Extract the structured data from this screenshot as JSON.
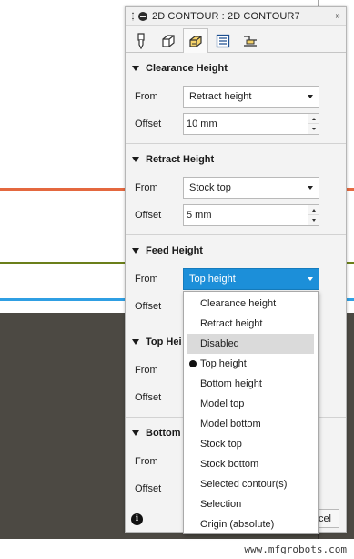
{
  "colors": {
    "orange_line": "#e4683f",
    "green_line": "#6b7f1a",
    "blue_line": "#2f9fe3",
    "dark_area": "#4c4943",
    "accent": "#1c8fd9"
  },
  "panel": {
    "title": "2D CONTOUR : 2D CONTOUR7",
    "expand_icon": "double-chevron-right-icon",
    "tabs": [
      {
        "icon": "tool-icon",
        "active": false
      },
      {
        "icon": "geometry-icon",
        "active": false
      },
      {
        "icon": "heights-icon",
        "active": true
      },
      {
        "icon": "passes-icon",
        "active": false
      },
      {
        "icon": "linking-icon",
        "active": false
      }
    ]
  },
  "clearance": {
    "title": "Clearance Height",
    "from_label": "From",
    "from_value": "Retract height",
    "offset_label": "Offset",
    "offset_value": "10 mm"
  },
  "retract": {
    "title": "Retract Height",
    "from_label": "From",
    "from_value": "Stock top",
    "offset_label": "Offset",
    "offset_value": "5 mm"
  },
  "feed": {
    "title": "Feed Height",
    "from_label": "From",
    "from_value": "Top height",
    "offset_label": "Offset"
  },
  "top": {
    "title": "Top Hei",
    "from_label": "From",
    "offset_label": "Offset"
  },
  "bottom": {
    "title": "Bottom",
    "from_label": "From",
    "offset_label": "Offset"
  },
  "footer": {
    "info_glyph": "i",
    "cancel_label": "cel"
  },
  "dropdown": {
    "items": [
      {
        "label": "Clearance height",
        "state": "normal"
      },
      {
        "label": "Retract height",
        "state": "normal"
      },
      {
        "label": "Disabled",
        "state": "hover"
      },
      {
        "label": "Top height",
        "state": "selected"
      },
      {
        "label": "Bottom height",
        "state": "normal"
      },
      {
        "label": "Model top",
        "state": "normal"
      },
      {
        "label": "Model bottom",
        "state": "normal"
      },
      {
        "label": "Stock top",
        "state": "normal"
      },
      {
        "label": "Stock bottom",
        "state": "normal"
      },
      {
        "label": "Selected contour(s)",
        "state": "normal"
      },
      {
        "label": "Selection",
        "state": "normal"
      },
      {
        "label": "Origin (absolute)",
        "state": "normal"
      }
    ]
  },
  "watermark": "www.mfgrobots.com"
}
